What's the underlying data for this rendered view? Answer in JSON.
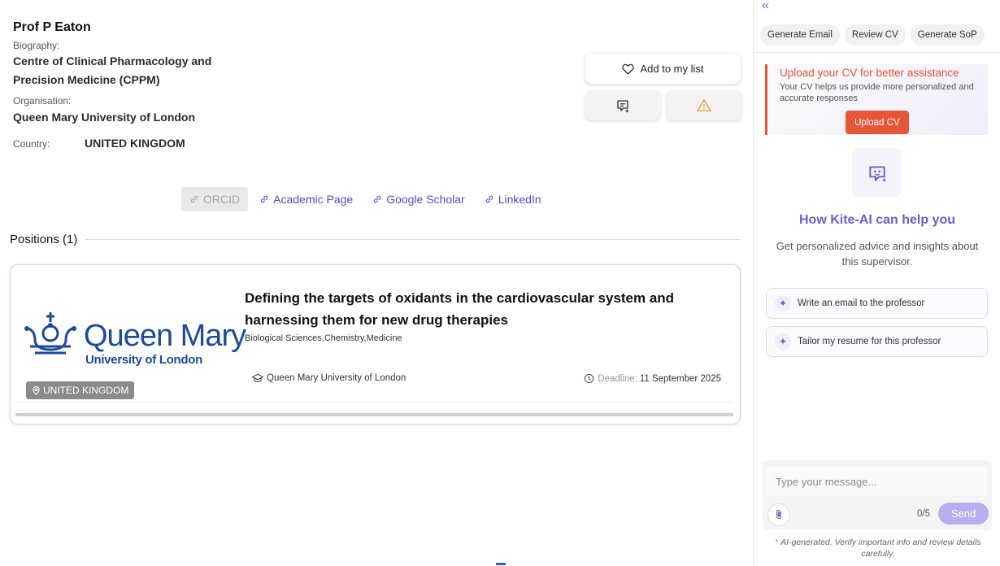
{
  "profile": {
    "name": "Prof P Eaton",
    "biography_label": "Biography:",
    "biography_line1": "Centre of Clinical Pharmacology and",
    "biography_line2": "Precision Medicine (CPPM)",
    "organisation_label": "Organisation:",
    "organisation": "Queen Mary University of London",
    "country_label": "Country:",
    "country": "UNITED KINGDOM"
  },
  "actions": {
    "add_to_list": "Add to my list",
    "accent_warning": "#e0a030"
  },
  "links": {
    "orcid": "ORCID",
    "academic_page": "Academic Page",
    "google_scholar": "Google Scholar",
    "linkedin": "LinkedIn"
  },
  "positions": {
    "header": "Positions (1)",
    "items": [
      {
        "logo_name": "Queen Mary",
        "logo_subtitle": "University of London",
        "country": "UNITED KINGDOM",
        "title_line1": "Defining the targets of oxidants in the cardiovascular system and",
        "title_line2": "harnessing them for new drug therapies",
        "subjects": "Biological Sciences,Chemistry,Medicine",
        "university": "Queen Mary University of London",
        "deadline_label": "Deadline:",
        "deadline": "11 September 2025"
      }
    ]
  },
  "assistant": {
    "collapse_glyph": "«",
    "quick_actions": [
      "Generate Email",
      "Review CV",
      "Generate SoP"
    ],
    "upload_title": "Upload your CV for better assistance",
    "upload_desc": "Your CV helps us provide more personalized and accurate responses",
    "upload_button": "Upload CV",
    "help_title": "How Kite-AI can help you",
    "help_desc": "Get personalized advice and insights about this supervisor.",
    "suggestions": [
      "Write an email to the professor",
      "Tailor my resume for this professor"
    ],
    "input_placeholder": "Type your message...",
    "counter": "0/5",
    "send_label": "Send",
    "disclaimer_star": "*",
    "disclaimer": "AI-generated. Verify important info and review details carefully.",
    "accent_color": "#6b5cd1",
    "upload_color": "#e8563a"
  }
}
